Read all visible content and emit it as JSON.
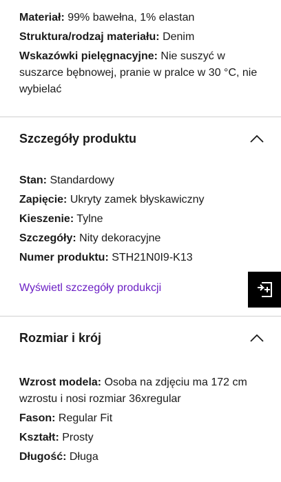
{
  "top_attrs": [
    {
      "key": "Materiał:",
      "value": "99% bawełna, 1% elastan"
    },
    {
      "key": "Struktura/rodzaj materiału:",
      "value": "Denim"
    },
    {
      "key": "Wskazówki pielęgnacyjne:",
      "value": "Nie suszyć w suszarce bębnowej, pranie w pralce w 30 °C, nie wybielać"
    }
  ],
  "product_details": {
    "title": "Szczegóły produktu",
    "attrs": [
      {
        "key": "Stan:",
        "value": "Standardowy"
      },
      {
        "key": "Zapięcie:",
        "value": "Ukryty zamek błyskawiczny"
      },
      {
        "key": "Kieszenie:",
        "value": "Tylne"
      },
      {
        "key": "Szczegóły:",
        "value": "Nity dekoracyjne"
      },
      {
        "key": "Numer produktu:",
        "value": "STH21N0I9-K13"
      }
    ],
    "link": "Wyświetl szczegóły produkcji"
  },
  "size_fit": {
    "title": "Rozmiar i krój",
    "attrs": [
      {
        "key": "Wzrost modela:",
        "value": "Osoba na zdjęciu ma 172 cm wzrostu i nosi rozmiar 36xregular"
      },
      {
        "key": "Fason:",
        "value": "Regular Fit"
      },
      {
        "key": "Kształt:",
        "value": "Prosty"
      },
      {
        "key": "Długość:",
        "value": "Długa"
      }
    ]
  },
  "icons": {
    "chevron": "chevron-up-icon",
    "fab": "share-arrow-icon"
  },
  "colors": {
    "link": "#6b1fc4",
    "fab_bg": "#000000",
    "divider": "#d0d0d0"
  }
}
